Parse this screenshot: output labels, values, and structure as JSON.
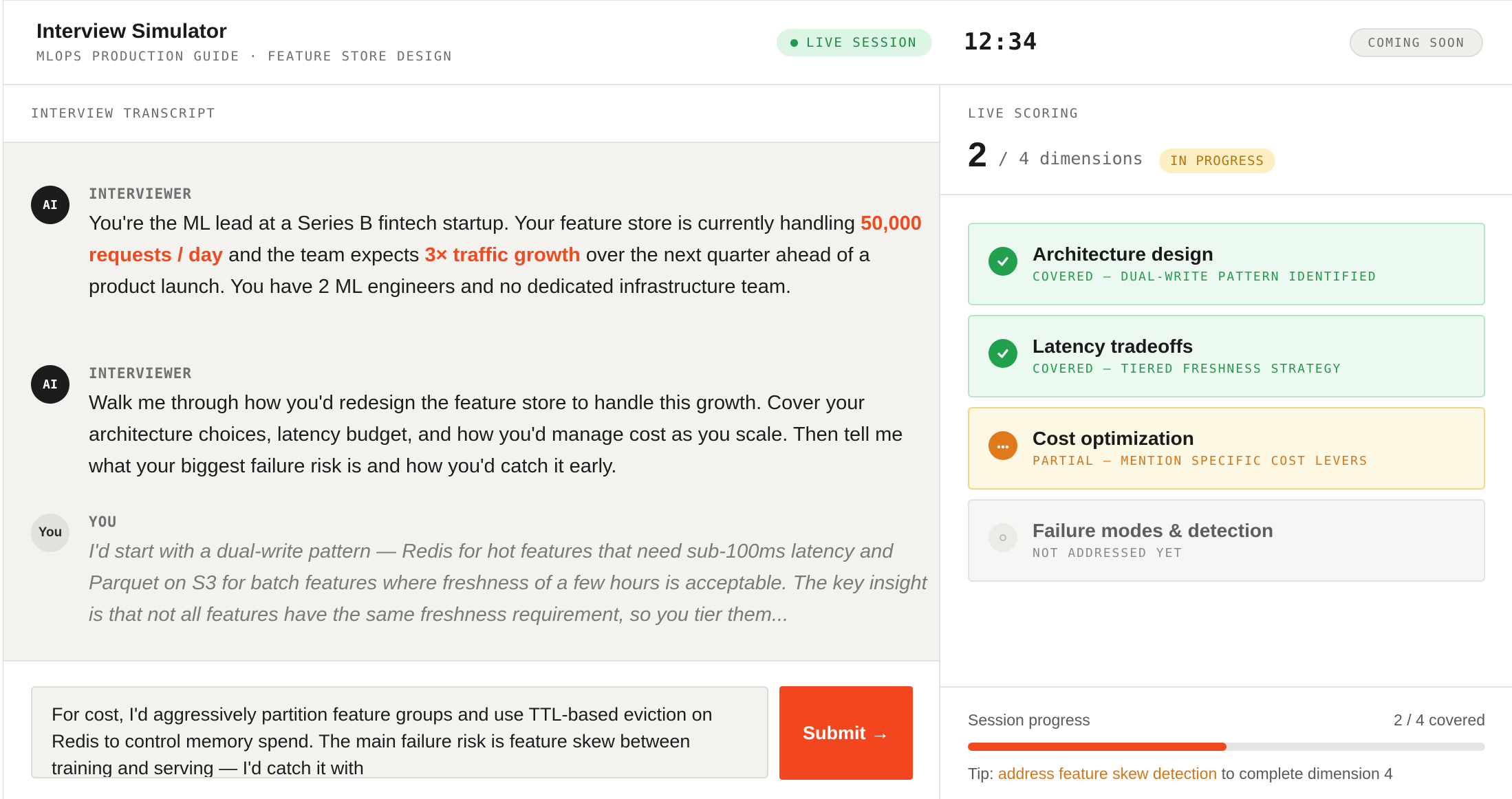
{
  "header": {
    "title": "Interview Simulator",
    "subtitle": "MLOPS PRODUCTION GUIDE · FEATURE STORE DESIGN",
    "live_label": "LIVE SESSION",
    "timer": "12:34",
    "coming_soon": "COMING SOON"
  },
  "transcript": {
    "label": "INTERVIEW TRANSCRIPT",
    "messages": [
      {
        "avatar": "AI",
        "speaker": "INTERVIEWER",
        "parts": [
          "You're the ML lead at a Series B fintech startup. Your feature store is currently handling ",
          "50,000 requests / day",
          " and the team expects ",
          "3× traffic growth",
          " over the next quarter ahead of a product launch. You have 2 ML engineers and no dedicated infrastructure team."
        ]
      },
      {
        "avatar": "AI",
        "speaker": "INTERVIEWER",
        "text": "Walk me through how you'd redesign the feature store to handle this growth. Cover your architecture choices, latency budget, and how you'd manage cost as you scale. Then tell me what your biggest failure risk is and how you'd catch it early."
      },
      {
        "avatar": "You",
        "speaker": "YOU",
        "text": "I'd start with a dual-write pattern — Redis for hot features that need sub-100ms latency and Parquet on S3 for batch features where freshness of a few hours is acceptable. The key insight is that not all features have the same freshness requirement, so you tier them..."
      }
    ]
  },
  "composer": {
    "value": "For cost, I'd aggressively partition feature groups and use TTL-based eviction on Redis to control memory spend. The main failure risk is feature skew between training and serving — I'd catch it with",
    "submit_label": "Submit →"
  },
  "scoring": {
    "label": "LIVE SCORING",
    "count": "2",
    "count_rest": "/ 4 dimensions",
    "status_badge": "IN PROGRESS",
    "dimensions": [
      {
        "title": "Architecture design",
        "status": "COVERED — DUAL-WRITE PATTERN IDENTIFIED",
        "state": "covered",
        "icon": "check-icon"
      },
      {
        "title": "Latency tradeoffs",
        "status": "COVERED — TIERED FRESHNESS STRATEGY",
        "state": "covered",
        "icon": "check-icon"
      },
      {
        "title": "Cost optimization",
        "status": "PARTIAL — MENTION SPECIFIC COST LEVERS",
        "state": "partial",
        "icon": "ellipsis-icon"
      },
      {
        "title": "Failure modes & detection",
        "status": "NOT ADDRESSED YET",
        "state": "none",
        "icon": "empty-circle-icon"
      }
    ]
  },
  "progress": {
    "label": "Session progress",
    "count": "2 / 4 covered",
    "fraction": 0.5,
    "tip_prefix": "Tip: ",
    "tip_link": "address feature skew detection",
    "tip_suffix": " to complete dimension 4"
  },
  "colors": {
    "accent": "#f04a1e",
    "covered": "#21a04e",
    "partial": "#e0791a",
    "live": "#1e9a4c"
  }
}
